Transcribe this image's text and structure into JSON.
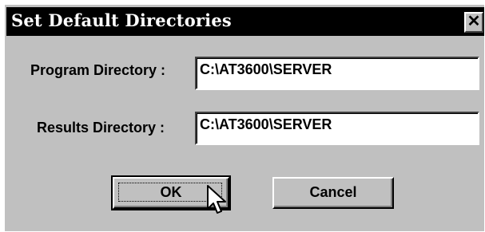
{
  "dialog": {
    "title": "Set Default Directories",
    "close_glyph": "✕"
  },
  "program_directory": {
    "label": "Program Directory :",
    "value": "C:\\AT3600\\SERVER"
  },
  "results_directory": {
    "label": "Results Directory :",
    "value": "C:\\AT3600\\SERVER"
  },
  "buttons": {
    "ok_label": "OK",
    "cancel_label": "Cancel"
  },
  "icons": {
    "close": "close-icon",
    "cursor": "mouse-pointer-icon"
  },
  "colors": {
    "face": "#c0c0c0",
    "titlebar": "#000000",
    "title_text": "#ffffff",
    "field_bg": "#ffffff"
  }
}
